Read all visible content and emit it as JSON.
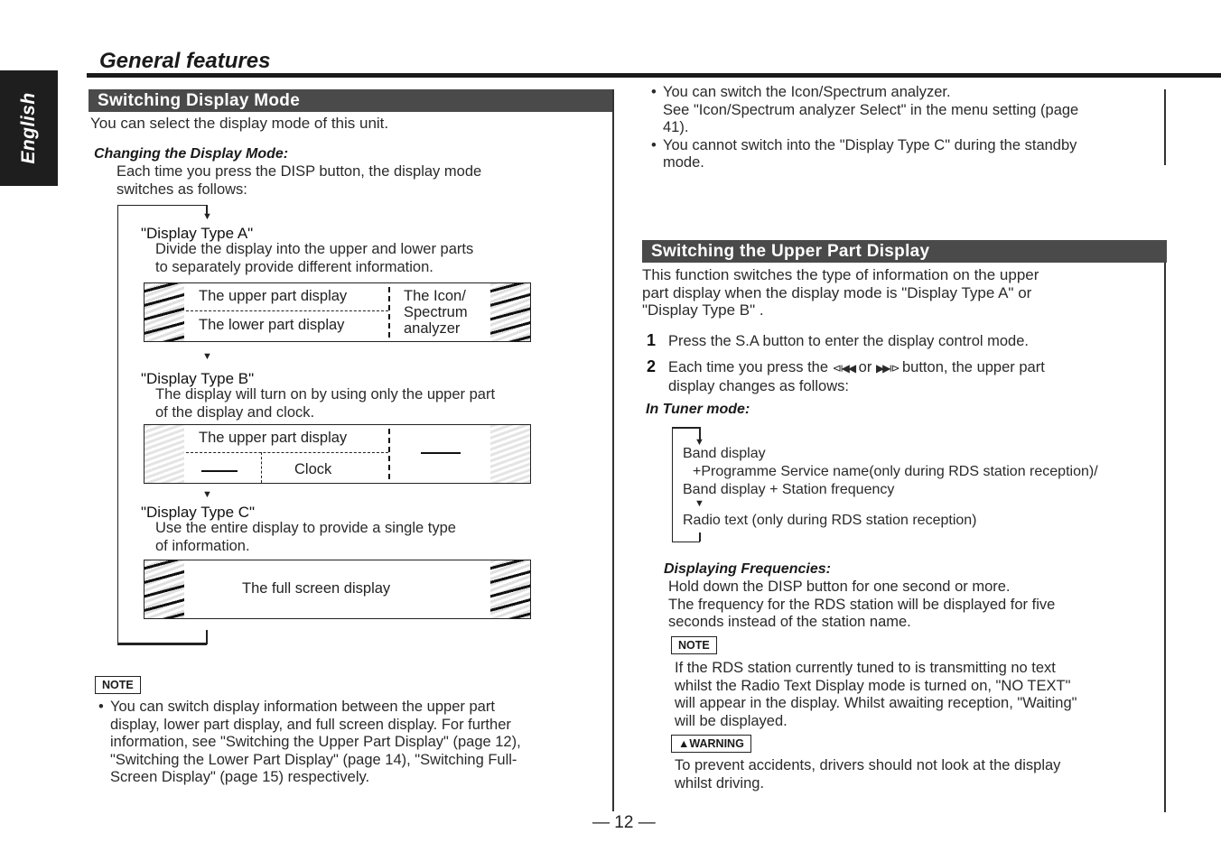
{
  "sidebar_tab": {
    "label": "English"
  },
  "header": {
    "title": "General features"
  },
  "left": {
    "section_title": "Switching Display Mode",
    "intro": "You can select the display mode of this unit.",
    "subheading": "Changing the Display Mode:",
    "instruction_lines": [
      "Each time you press the DISP button, the display mode",
      "switches as follows:"
    ],
    "modes": [
      {
        "title": "\"Display Type A\"",
        "desc_lines": [
          "Divide the display into the upper and lower parts",
          "to separately provide different information."
        ],
        "panel": {
          "upper": "The upper part display",
          "lower": "The lower part display",
          "right_lines": [
            "The Icon/",
            "Spectrum",
            "analyzer"
          ]
        }
      },
      {
        "title": "\"Display Type B\"",
        "desc_lines": [
          "The display will turn on by using only the upper part",
          "of the display and clock."
        ],
        "panel": {
          "upper": "The upper part display",
          "clock": "Clock"
        }
      },
      {
        "title": "\"Display Type C\"",
        "desc_lines": [
          "Use the entire display to provide a single type",
          "of information."
        ],
        "panel": {
          "full": "The full screen display"
        }
      }
    ],
    "note_label": "NOTE",
    "note_lines": [
      "You can switch display information between the upper part",
      "display, lower part display, and full screen display. For further",
      "information, see \"Switching the Upper Part Display\" (page 12),",
      "\"Switching the Lower Part Display\" (page 14), \"Switching Full-",
      "Screen Display\" (page 15) respectively."
    ]
  },
  "right": {
    "bullets": [
      {
        "lines": [
          "You can switch the Icon/Spectrum analyzer.",
          "See \"Icon/Spectrum analyzer Select\" in the menu setting (page",
          "41)."
        ]
      },
      {
        "lines": [
          "You cannot switch into the \"Display Type C\" during the standby",
          "mode."
        ]
      }
    ],
    "section_title": "Switching the Upper Part Display",
    "intro_lines": [
      "This function switches the type of information on the upper",
      "part display when the display mode is \"Display Type A\" or",
      "\"Display Type B\" ."
    ],
    "steps": [
      {
        "num": "1",
        "lines": [
          "Press the S.A button to enter the display control mode."
        ]
      },
      {
        "num": "2",
        "line1_a": "Each time you press the",
        "prev_icon": "⧏◀◀",
        "line1_or": "or",
        "next_icon": "▶▶⧐",
        "line1_b": "button, the upper part",
        "line2": "display changes as follows:"
      }
    ],
    "tuner_heading": "In Tuner mode:",
    "tuner_flow": {
      "item1_lines": [
        "Band display",
        "+Programme Service name(only during RDS station reception)/",
        "Band display + Station frequency"
      ],
      "item2": "Radio text (only during RDS station reception)"
    },
    "freq_heading": "Displaying Frequencies:",
    "freq_lines": [
      "Hold down the DISP button for one second or more.",
      "The frequency for the RDS station will be displayed for five",
      "seconds instead of the station name."
    ],
    "note_label": "NOTE",
    "note_lines": [
      "If the RDS station currently tuned to is transmitting no text",
      "whilst the Radio Text Display mode is turned on, \"NO TEXT\"",
      "will appear in the display. Whilst awaiting reception, \"Waiting\"",
      "will be displayed."
    ],
    "warning_label": "WARNING",
    "warning_lines": [
      "To prevent accidents, drivers should not look at the display",
      "whilst driving."
    ]
  },
  "footer": {
    "page_number": "— 12 —"
  }
}
